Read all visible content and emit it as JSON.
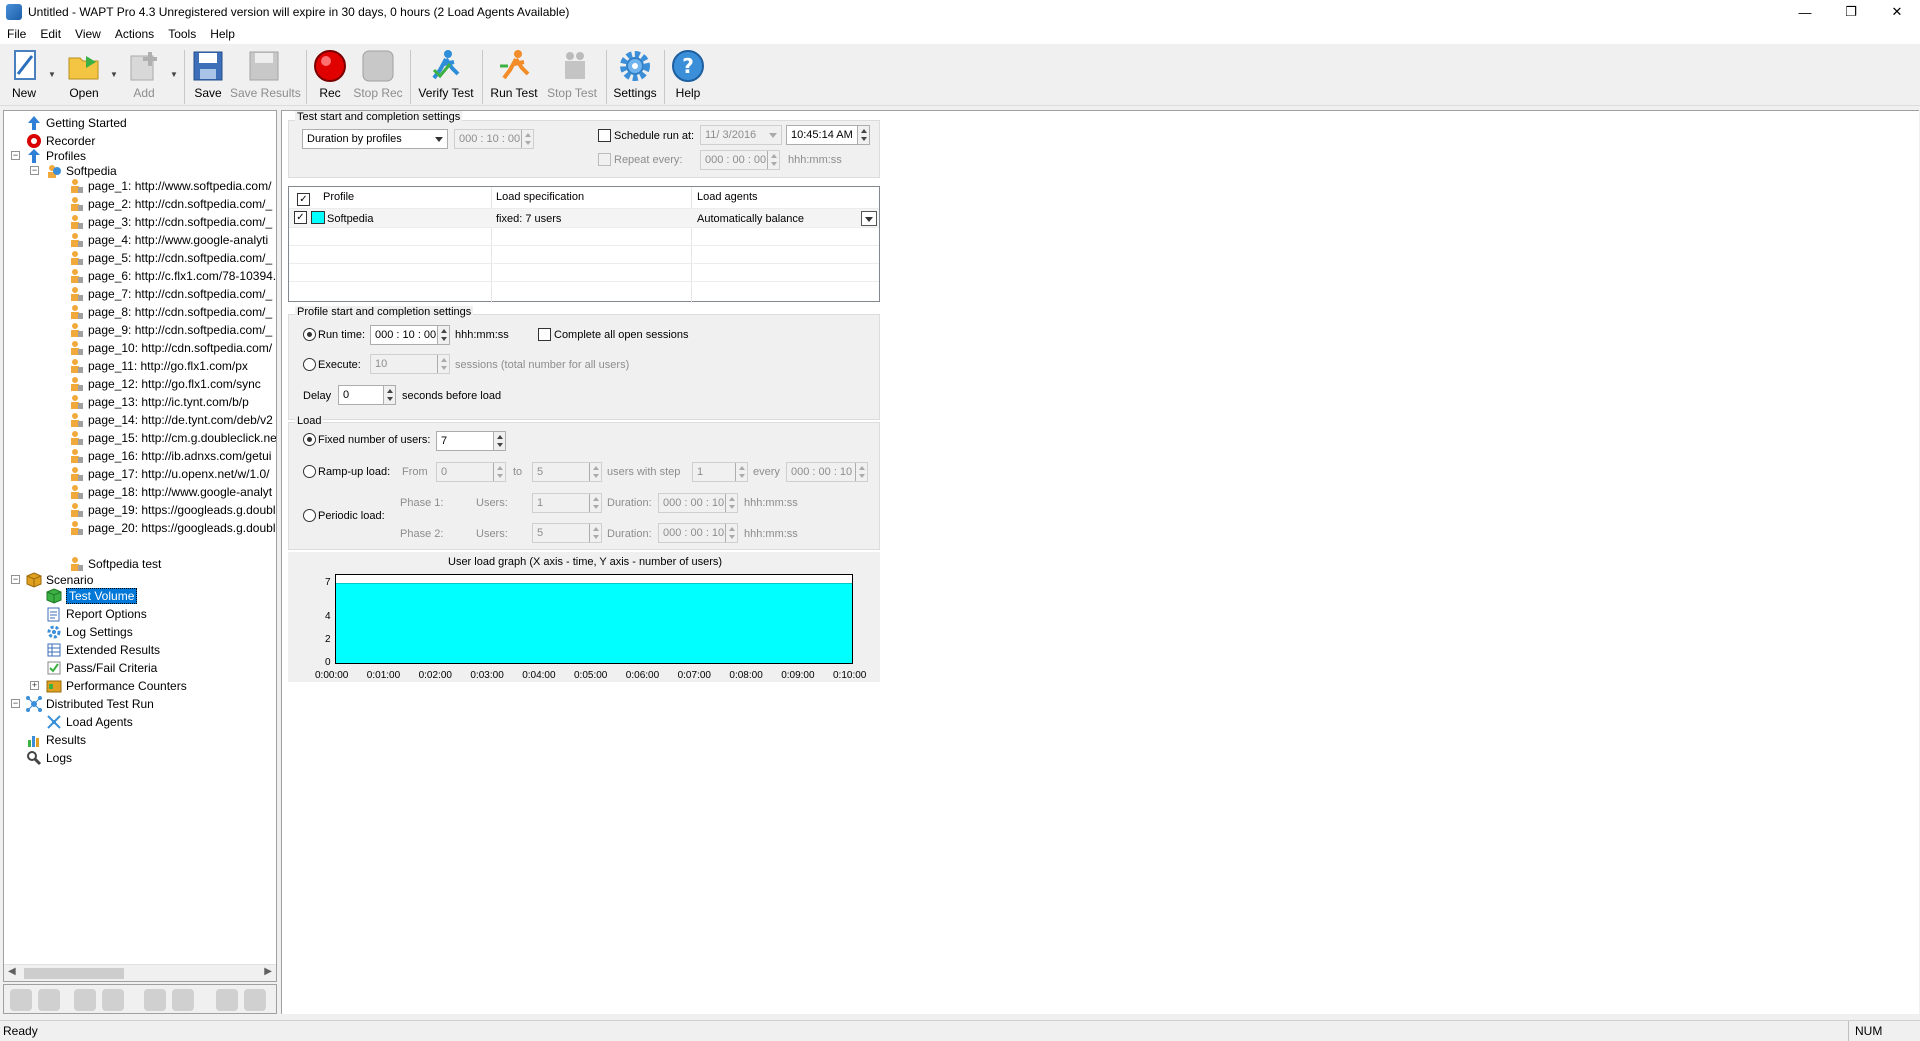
{
  "window": {
    "title": "Untitled - WAPT Pro 4.3  Unregistered version will expire in 30 days, 0 hours (2 Load Agents Available)",
    "minimize": "—",
    "restore": "❐",
    "close": "✕"
  },
  "menu": [
    "File",
    "Edit",
    "View",
    "Actions",
    "Tools",
    "Help"
  ],
  "toolbar": {
    "new": "New",
    "open": "Open",
    "add": "Add",
    "save": "Save",
    "save_results": "Save Results",
    "rec": "Rec",
    "stop_rec": "Stop Rec",
    "verify_test": "Verify Test",
    "run_test": "Run Test",
    "stop_test": "Stop Test",
    "settings": "Settings",
    "help": "Help"
  },
  "tree": {
    "getting_started": "Getting Started",
    "recorder": "Recorder",
    "profiles": "Profiles",
    "softpedia": "Softpedia",
    "pages": [
      "page_1: http://www.softpedia.com/",
      "page_2: http://cdn.softpedia.com/_",
      "page_3: http://cdn.softpedia.com/_",
      "page_4: http://www.google-analyti",
      "page_5: http://cdn.softpedia.com/_",
      "page_6: http://c.flx1.com/78-10394.",
      "page_7: http://cdn.softpedia.com/_",
      "page_8: http://cdn.softpedia.com/_",
      "page_9: http://cdn.softpedia.com/_",
      "page_10: http://cdn.softpedia.com/",
      "page_11: http://go.flx1.com/px",
      "page_12: http://go.flx1.com/sync",
      "page_13: http://ic.tynt.com/b/p",
      "page_14: http://de.tynt.com/deb/v2",
      "page_15: http://cm.g.doubleclick.ne",
      "page_16: http://ib.adnxs.com/getui",
      "page_17: http://u.openx.net/w/1.0/",
      "page_18: http://www.google-analyt",
      "page_19: https://googleads.g.doubl",
      "page_20: https://googleads.g.doubl"
    ],
    "softpedia_test": "Softpedia test",
    "scenario": "Scenario",
    "test_volume": "Test Volume",
    "report_options": "Report Options",
    "log_settings": "Log Settings",
    "extended_results": "Extended Results",
    "pass_fail": "Pass/Fail Criteria",
    "perf_counters": "Performance Counters",
    "distributed": "Distributed Test Run",
    "load_agents": "Load Agents",
    "results": "Results",
    "logs": "Logs"
  },
  "test_settings": {
    "group_title": "Test start and completion settings",
    "duration_mode": "Duration by profiles",
    "duration_value": "000 : 10 : 00",
    "schedule_label": "Schedule run at:",
    "schedule_date": "11/  3/2016",
    "schedule_time": "10:45:14 AM",
    "repeat_label": "Repeat every:",
    "repeat_value": "000 : 00 : 00",
    "repeat_unit": "hhh:mm:ss"
  },
  "profile_table": {
    "headers": [
      "Profile",
      "Load specification",
      "Load agents"
    ],
    "rows": [
      {
        "profile": "Softpedia",
        "load_spec": "fixed: 7 users",
        "agents": "Automatically balance"
      }
    ]
  },
  "profile_settings": {
    "group_title": "Profile start and completion settings",
    "run_time_label": "Run time:",
    "run_time_value": "000 : 10 : 00",
    "run_time_unit": "hhh:mm:ss",
    "complete_sessions": "Complete all open sessions",
    "execute_label": "Execute:",
    "execute_value": "10",
    "execute_note": "sessions (total number for all users)",
    "delay_label": "Delay",
    "delay_value": "0",
    "delay_note": "seconds before load"
  },
  "load": {
    "group_title": "Load",
    "fixed_label": "Fixed number of users:",
    "fixed_value": "7",
    "rampup_label": "Ramp-up load:",
    "from_label": "From",
    "from_value": "0",
    "to_label": "to",
    "to_value": "5",
    "step_label": "users with step",
    "step_value": "1",
    "every_label": "every",
    "every_value": "000 : 00 : 10",
    "periodic_label": "Periodic load:",
    "phase1_label": "Phase 1:",
    "phase2_label": "Phase 2:",
    "users_label": "Users:",
    "phase1_users": "1",
    "phase2_users": "5",
    "duration_label": "Duration:",
    "phase1_duration": "000 : 00 : 10",
    "phase2_duration": "000 : 00 : 10",
    "unit": "hhh:mm:ss"
  },
  "chart_data": {
    "type": "area",
    "title": "User load graph (X axis - time, Y axis - number of users)",
    "x": [
      "0:00:00",
      "0:01:00",
      "0:02:00",
      "0:03:00",
      "0:04:00",
      "0:05:00",
      "0:06:00",
      "0:07:00",
      "0:08:00",
      "0:09:00",
      "0:10:00"
    ],
    "series": [
      {
        "values": [
          7,
          7,
          7,
          7,
          7,
          7,
          7,
          7,
          7,
          7,
          7
        ]
      }
    ],
    "yticks": [
      "0",
      "2",
      "4",
      "7"
    ],
    "ylim": [
      0,
      7
    ],
    "fill_color": "#00ffff"
  },
  "status": {
    "left": "Ready",
    "right": "NUM"
  }
}
